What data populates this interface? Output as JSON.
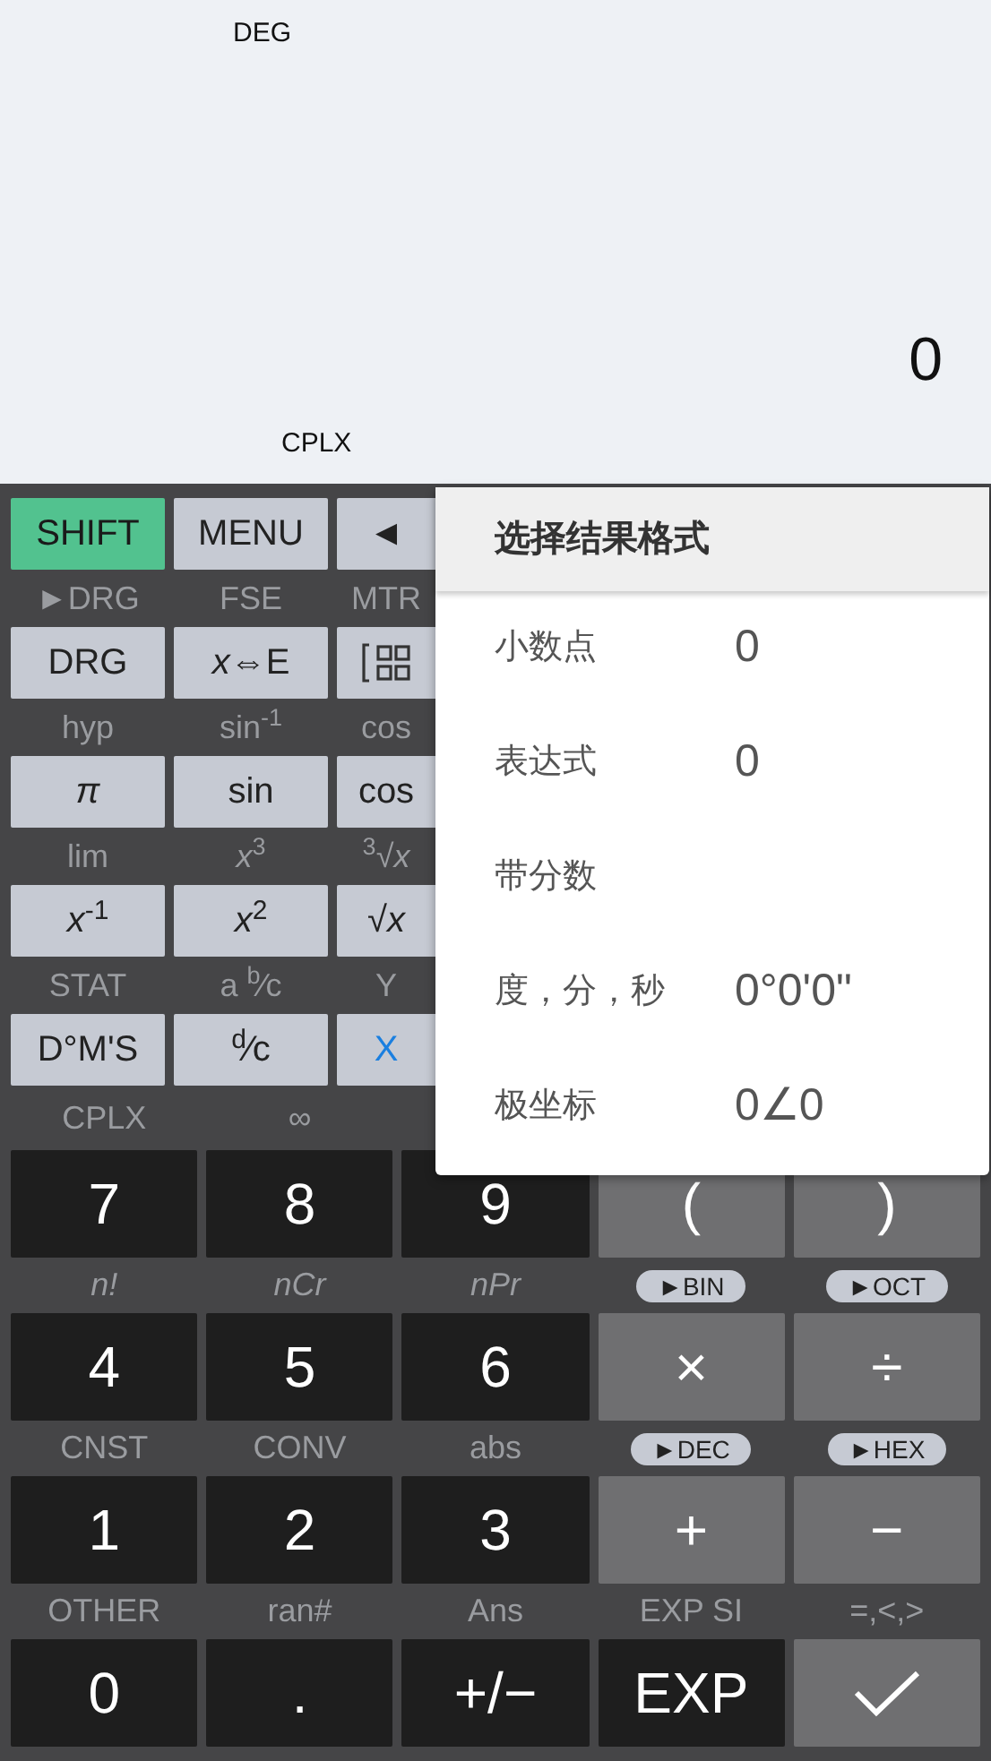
{
  "display": {
    "angle_mode": "DEG",
    "result": "0",
    "mode": "CPLX"
  },
  "upper_rows": [
    {
      "labels": [],
      "keys": [
        {
          "kind": "toggle",
          "label": "SHIFT"
        },
        {
          "kind": "function",
          "label": "MENU"
        },
        {
          "kind": "function",
          "label": "◄"
        }
      ]
    },
    {
      "labels": [
        "►DRG",
        "FSE",
        "MTR"
      ],
      "keys": [
        {
          "kind": "function",
          "label": "DRG"
        },
        {
          "kind": "function",
          "label": "*x*⇔E"
        },
        {
          "kind": "matrix"
        }
      ]
    },
    {
      "labels": [
        "hyp",
        "sin$^{-1}$",
        "cos"
      ],
      "keys": [
        {
          "kind": "function",
          "label": "π",
          "italic": true
        },
        {
          "kind": "function",
          "label": "sin"
        },
        {
          "kind": "function",
          "label": "cos"
        }
      ]
    },
    {
      "labels": [
        "lim",
        "*x*$^{3}$",
        "$^{3}$√*x*"
      ],
      "keys": [
        {
          "kind": "function",
          "label": "*x*$^{-1}$"
        },
        {
          "kind": "function",
          "label": "*x*$^{2}$"
        },
        {
          "kind": "function",
          "label": "√*x*"
        }
      ]
    },
    {
      "labels": [
        "STAT",
        "a $^{b}$⁄c",
        "Y"
      ],
      "keys": [
        {
          "kind": "function",
          "label": "D°M'S"
        },
        {
          "kind": "function",
          "label": "$^{d}$⁄c"
        },
        {
          "kind": "variable",
          "label": "X"
        }
      ]
    }
  ],
  "lower_rows": [
    {
      "labels": [
        {
          "kind": "text",
          "text": "CPLX"
        },
        {
          "kind": "text",
          "text": "∞"
        }
      ],
      "keys": [
        {
          "kind": "digit",
          "label": "7"
        },
        {
          "kind": "digit",
          "label": "8"
        },
        {
          "kind": "digit",
          "label": "9"
        },
        {
          "kind": "operator",
          "label": "("
        },
        {
          "kind": "operator",
          "label": ")"
        }
      ]
    },
    {
      "labels": [
        {
          "kind": "text",
          "text": "n!",
          "italic": true
        },
        {
          "kind": "text",
          "text": "nCr",
          "italic": true
        },
        {
          "kind": "text",
          "text": "nPr",
          "italic": true
        },
        {
          "kind": "pill",
          "text": "►BIN"
        },
        {
          "kind": "pill",
          "text": "►OCT"
        }
      ],
      "keys": [
        {
          "kind": "digit",
          "label": "4"
        },
        {
          "kind": "digit",
          "label": "5"
        },
        {
          "kind": "digit",
          "label": "6"
        },
        {
          "kind": "operator",
          "label": "×"
        },
        {
          "kind": "operator",
          "label": "÷"
        }
      ]
    },
    {
      "labels": [
        {
          "kind": "text",
          "text": "CNST"
        },
        {
          "kind": "text",
          "text": "CONV"
        },
        {
          "kind": "text",
          "text": "abs"
        },
        {
          "kind": "pill",
          "text": "►DEC"
        },
        {
          "kind": "pill",
          "text": "►HEX"
        }
      ],
      "keys": [
        {
          "kind": "digit",
          "label": "1"
        },
        {
          "kind": "digit",
          "label": "2"
        },
        {
          "kind": "digit",
          "label": "3"
        },
        {
          "kind": "operator",
          "label": "+"
        },
        {
          "kind": "operator",
          "label": "−"
        }
      ]
    },
    {
      "labels": [
        {
          "kind": "text",
          "text": "OTHER"
        },
        {
          "kind": "text",
          "text": "ran#"
        },
        {
          "kind": "text",
          "text": "Ans"
        },
        {
          "kind": "text",
          "text": "EXP SI"
        },
        {
          "kind": "text",
          "text": "=,<,>"
        }
      ],
      "keys": [
        {
          "kind": "digit",
          "label": "0"
        },
        {
          "kind": "digit",
          "label": "."
        },
        {
          "kind": "digit",
          "label": "+/−"
        },
        {
          "kind": "digit",
          "label": "EXP"
        },
        {
          "kind": "confirm"
        }
      ]
    }
  ],
  "popup": {
    "title": "选择结果格式",
    "items": [
      {
        "label": "小数点",
        "value": "0"
      },
      {
        "label": "表达式",
        "value": "0"
      },
      {
        "label": "带分数"
      },
      {
        "label": "度，分，秒",
        "value": "0°0'0\""
      },
      {
        "label": "极坐标",
        "value": "0∠0"
      }
    ]
  }
}
